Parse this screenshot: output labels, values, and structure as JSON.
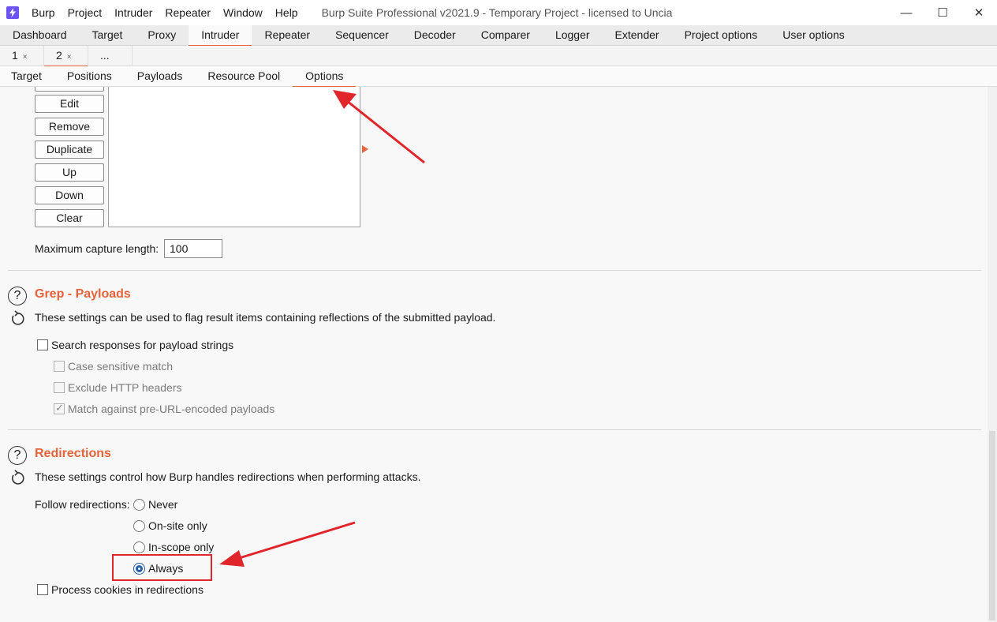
{
  "titlebar": {
    "menu": [
      "Burp",
      "Project",
      "Intruder",
      "Repeater",
      "Window",
      "Help"
    ],
    "title": "Burp Suite Professional v2021.9 - Temporary Project - licensed to Uncia",
    "minimize": "—",
    "maximize": "☐",
    "close": "✕"
  },
  "main_tabs": [
    "Dashboard",
    "Target",
    "Proxy",
    "Intruder",
    "Repeater",
    "Sequencer",
    "Decoder",
    "Comparer",
    "Logger",
    "Extender",
    "Project options",
    "User options"
  ],
  "main_tab_active": "Intruder",
  "instance_tabs": [
    {
      "label": "1",
      "close": "×"
    },
    {
      "label": "2",
      "close": "×"
    },
    {
      "label": "...",
      "close": ""
    }
  ],
  "intruder_tabs": [
    "Target",
    "Positions",
    "Payloads",
    "Resource Pool",
    "Options"
  ],
  "intruder_tab_active": "Options",
  "extract_buttons": [
    "Edit",
    "Remove",
    "Duplicate",
    "Up",
    "Down",
    "Clear"
  ],
  "max_capture": {
    "label": "Maximum capture length:",
    "value": "100"
  },
  "grep_payloads": {
    "title": "Grep - Payloads",
    "description": "These settings can be used to flag result items containing reflections of the submitted payload.",
    "search_label": "Search responses for payload strings",
    "case_label": "Case sensitive match",
    "exclude_label": "Exclude HTTP headers",
    "match_label": "Match against pre-URL-encoded payloads"
  },
  "redirections": {
    "title": "Redirections",
    "description": "These settings control how Burp handles redirections when performing attacks.",
    "follow_label": "Follow redirections:",
    "options": [
      "Never",
      "On-site only",
      "In-scope only",
      "Always"
    ],
    "selected": "Always",
    "cookies_label": "Process cookies in redirections"
  },
  "icons": {
    "help": "?",
    "app_logo": "⚡"
  },
  "colors": {
    "accent": "#e8633a",
    "annotation": "#e0262b",
    "radio_selected": "#245fa8"
  }
}
